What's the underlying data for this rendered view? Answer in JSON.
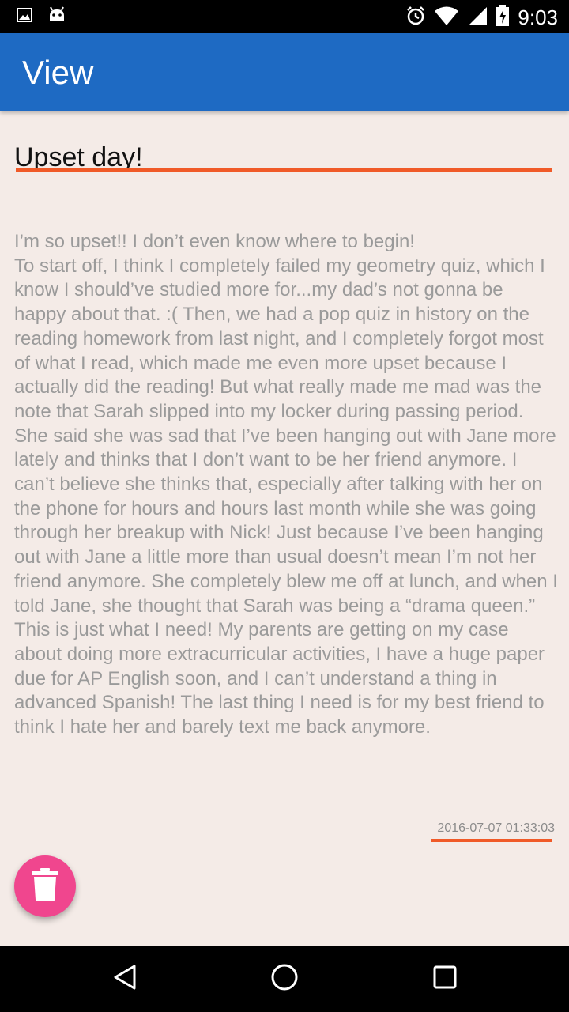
{
  "status_bar": {
    "time": "9:03",
    "icons": [
      "image-icon",
      "android-icon",
      "alarm-icon",
      "wifi-icon",
      "signal-icon",
      "battery-charging-icon"
    ]
  },
  "app_bar": {
    "title": "View"
  },
  "entry": {
    "title": "Upset day!",
    "body": "I’m so upset!! I don’t even know where to begin!\nTo start off, I think I completely failed my geometry quiz, which I know I should’ve studied more for...my dad’s not gonna be happy about that. :( Then, we had a pop quiz in history on the reading homework from last night, and I completely forgot most of what I read, which made me even more upset because I actually did the reading! But what really made me mad was the note that Sarah slipped into my locker during passing period. She said she was sad that I’ve been hanging out with Jane more lately and thinks that I don’t want to be her friend anymore. I can’t believe she thinks that, especially after talking with her on the phone for hours and hours last month while she was going through her breakup with Nick! Just because I’ve been hanging out with Jane a little more than usual doesn’t mean I’m not her friend anymore. She completely blew me off at lunch, and when I told Jane, she thought that Sarah was being a “drama queen.”\nThis is just what I need! My parents are getting on my case about doing more extracurricular activities, I have a huge paper due for AP English soon, and I can’t understand a thing in advanced Spanish! The last thing I need is for my best friend to think I hate her and barely text me back anymore.",
    "timestamp": "2016-07-07 01:33:03"
  },
  "fab": {
    "icon": "trash-icon"
  },
  "nav_bar": {
    "icons": [
      "back-icon",
      "home-icon",
      "recents-icon"
    ]
  },
  "colors": {
    "app_bar": "#1e6ac3",
    "accent": "#f05a28",
    "fab": "#f0468e",
    "background": "#f4ebe7"
  }
}
